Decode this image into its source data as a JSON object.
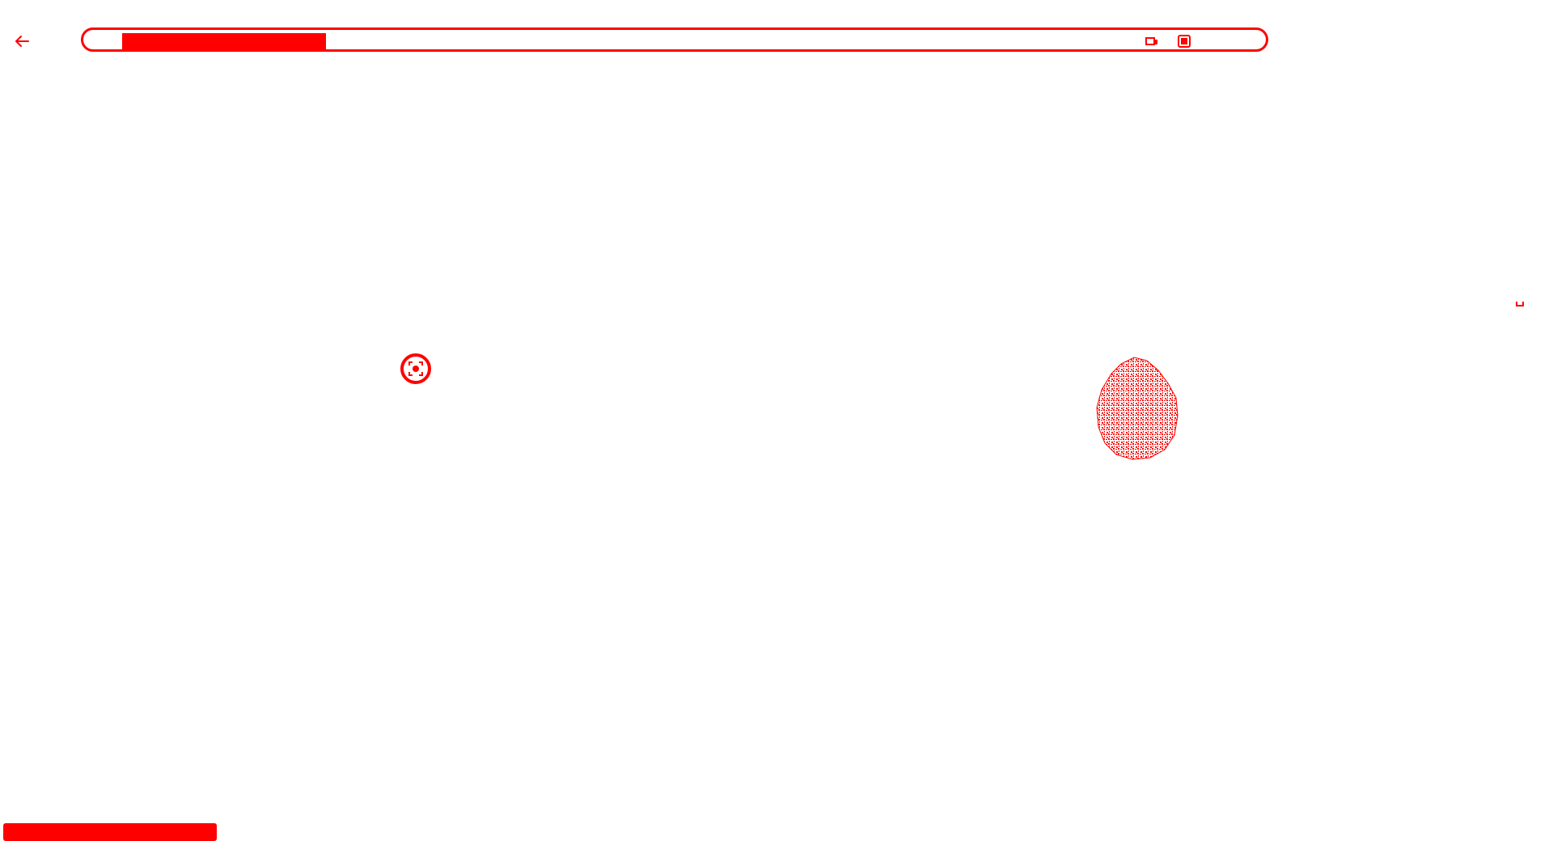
{
  "toolbar": {
    "back_icon": "arrow-left-icon",
    "search": {
      "value": "",
      "actions": [
        {
          "icon": "tablet-icon"
        },
        {
          "icon": "scan-icon"
        }
      ]
    }
  },
  "canvas": {
    "lens_icon": "camera-scan-icon",
    "blob_icon": "noise-blob-image"
  },
  "status": {
    "text": ""
  },
  "colors": {
    "accent": "#ff0000",
    "background": "#ffffff"
  }
}
